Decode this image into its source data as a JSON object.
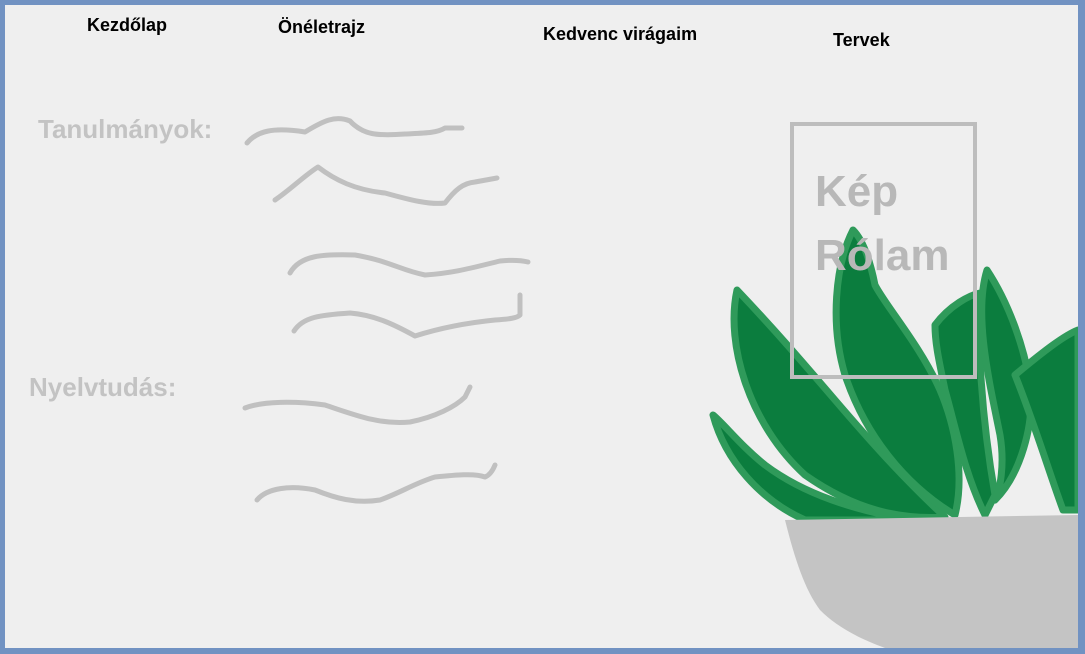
{
  "nav": {
    "home": "Kezdőlap",
    "cv": "Önéletrajz",
    "flowers": "Kedvenc virágaim",
    "plans": "Tervek"
  },
  "sections": {
    "studies": "Tanulmányok:",
    "languages": "Nyelvtudás:"
  },
  "photo": {
    "line1": "Kép",
    "line2": "Rólam"
  },
  "colors": {
    "frame": "#7192c2",
    "background": "#efefef",
    "scribble": "#bdbdbd",
    "leaf": "#0b7d3e",
    "leaf_outline": "#2f9a5a",
    "pot": "#c4c4c4"
  }
}
